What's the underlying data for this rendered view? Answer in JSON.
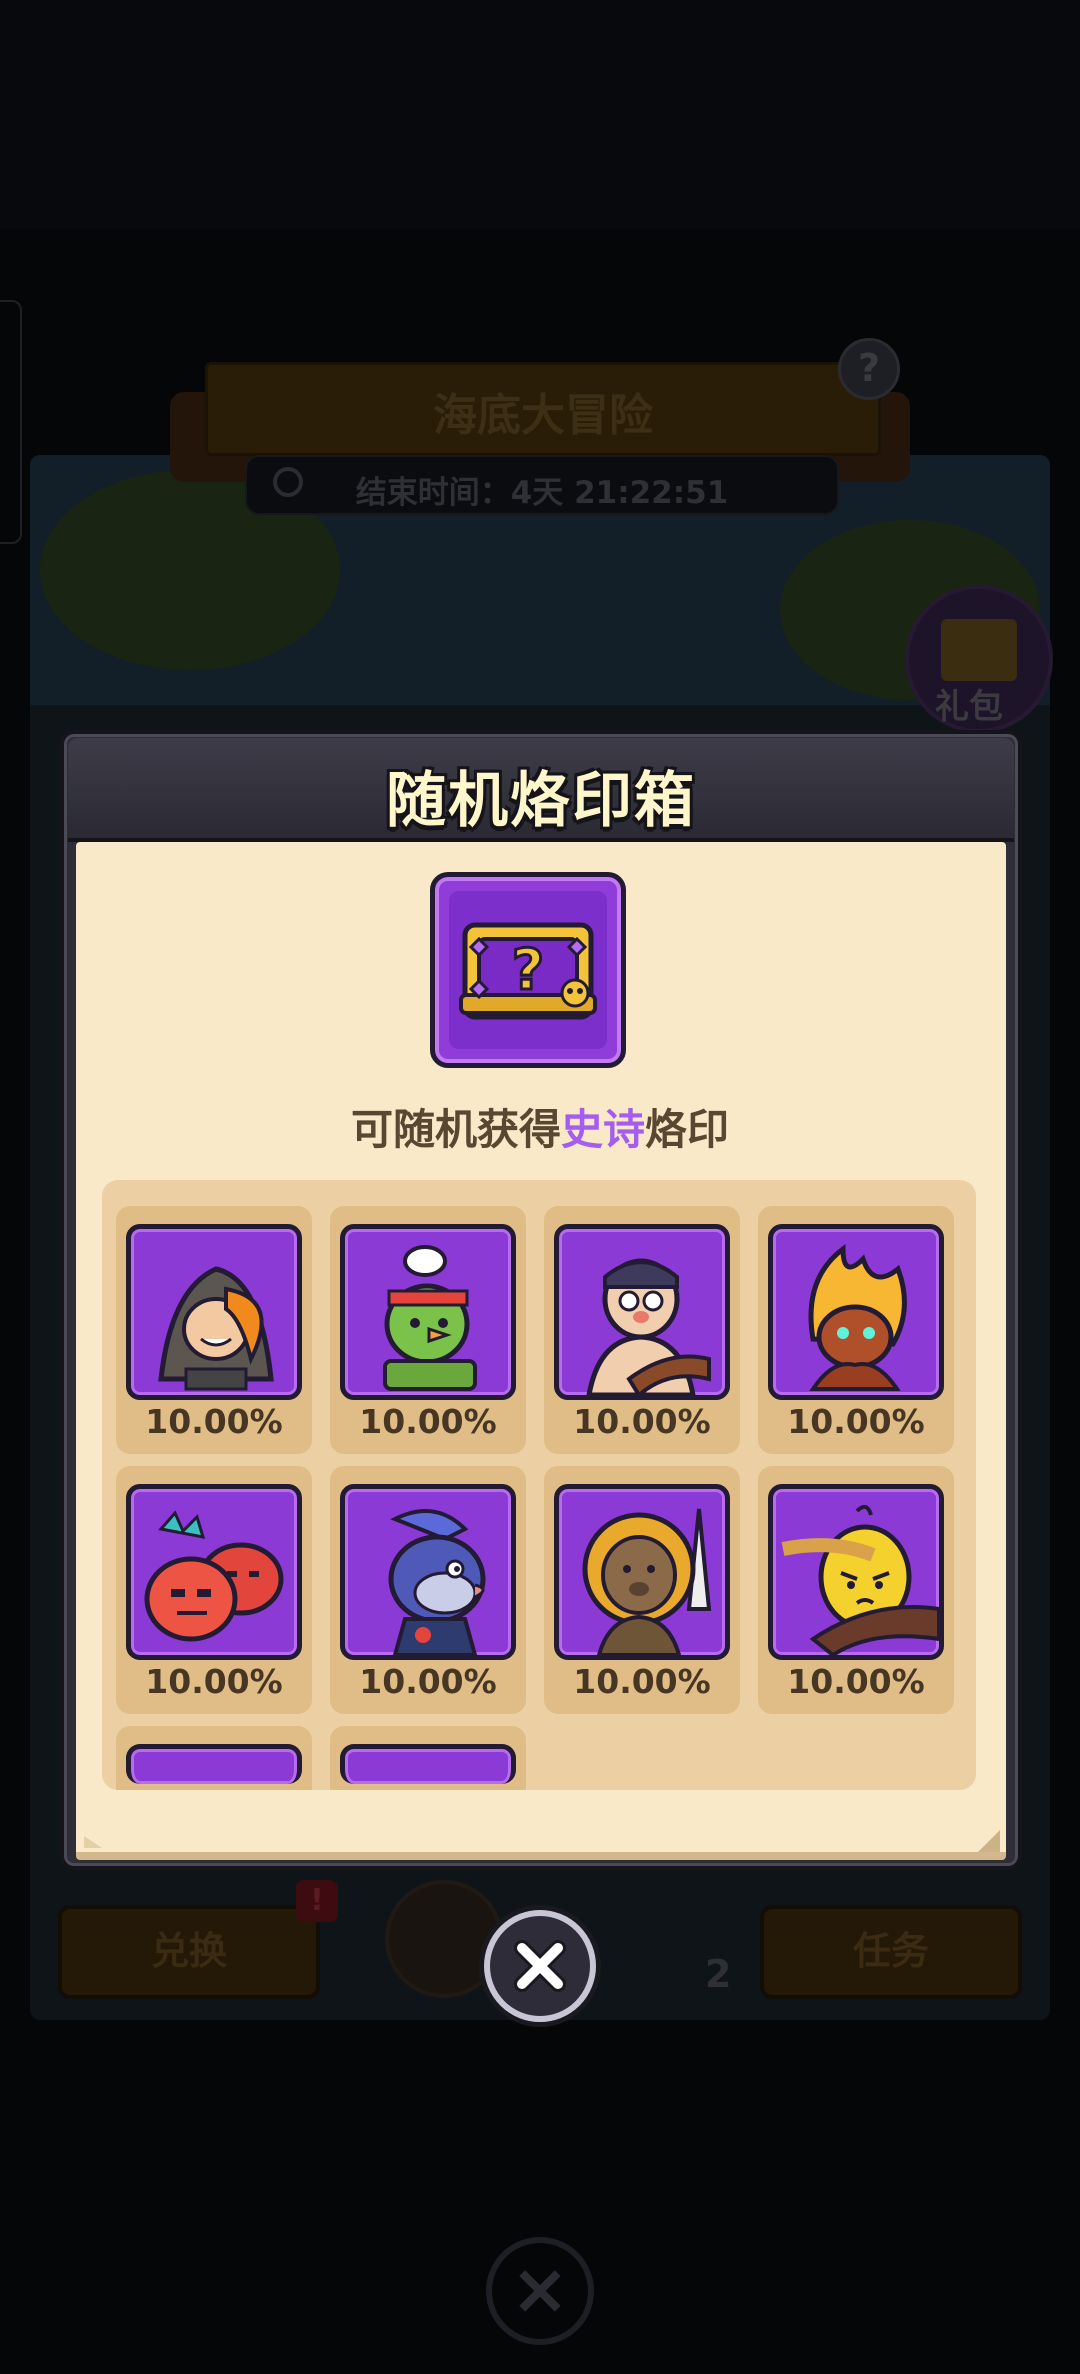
{
  "background": {
    "event_title": "海底大冒险",
    "timer_text": "结束时间：4天 21:22:51",
    "help_icon": "question-icon",
    "gift_label": "礼包",
    "exchange_label": "兑换",
    "exchange_alert": "!",
    "task_label": "任务",
    "item_count": "2"
  },
  "modal": {
    "title": "随机烙印箱",
    "chest_icon": "mystery-chest-icon",
    "subtitle_prefix": "可随机获得",
    "subtitle_highlight": "史诗",
    "subtitle_suffix": "烙印",
    "highlight_color": "#a45df0",
    "rarity_color": "#8b3ad6"
  },
  "items": [
    {
      "character": "hooded-rogue",
      "chance": "10.00%"
    },
    {
      "character": "goblin-chef",
      "chance": "10.00%"
    },
    {
      "character": "bearded-brawler",
      "chance": "10.00%"
    },
    {
      "character": "flame-sprite",
      "chance": "10.00%"
    },
    {
      "character": "red-hydra",
      "chance": "10.00%"
    },
    {
      "character": "fish-knight",
      "chance": "10.00%"
    },
    {
      "character": "lion-ape",
      "chance": "10.00%"
    },
    {
      "character": "banana-warrior",
      "chance": "10.00%"
    },
    {
      "character": "partial-hidden",
      "chance": ""
    },
    {
      "character": "partial-hidden",
      "chance": ""
    }
  ],
  "close_icon": "close-icon"
}
